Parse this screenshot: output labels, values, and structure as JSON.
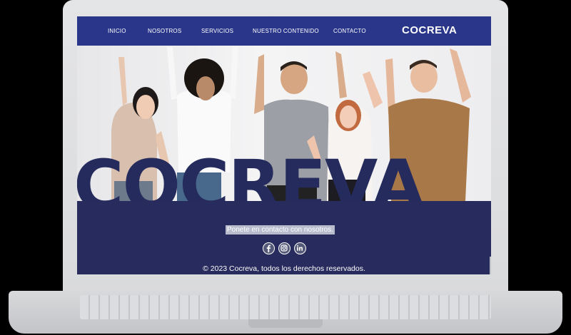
{
  "nav": {
    "items": [
      "INICIO",
      "NOSOTROS",
      "SERVICIOS",
      "NUESTRO CONTENIDO",
      "CONTACTO"
    ],
    "brand": "COCREVA"
  },
  "hero": {
    "big_word": "COCREVA"
  },
  "footer": {
    "contact_text": "Ponete en contacto con nosotros.",
    "social": [
      "facebook-icon",
      "instagram-icon",
      "linkedin-icon"
    ],
    "copyright": "© 2023 Cocreva, todos los derechos reservados."
  },
  "colors": {
    "nav": "#29368a",
    "footer": "#282b5d",
    "accent_text": "#252b5c"
  }
}
